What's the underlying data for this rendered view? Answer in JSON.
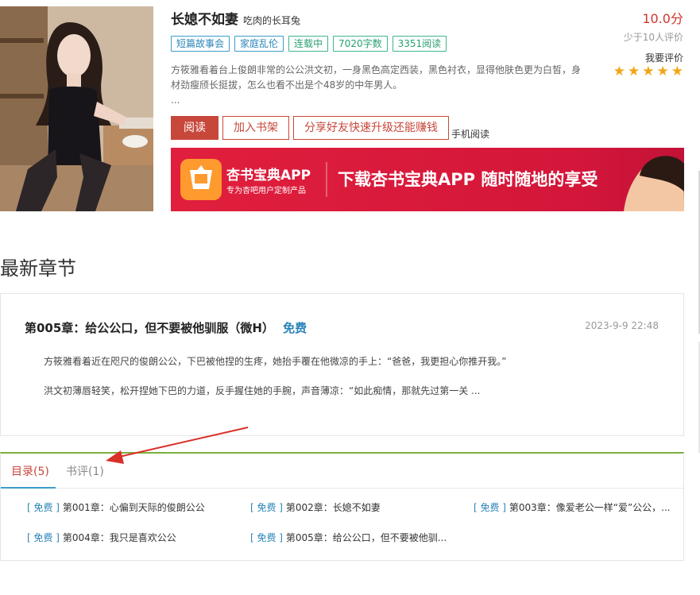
{
  "book": {
    "title": "长媳不如妻",
    "author": "吃肉的长耳兔",
    "tags": [
      {
        "label": "短篇故事会",
        "style": "blue"
      },
      {
        "label": "家庭乱伦",
        "style": "blue"
      },
      {
        "label": "连载中",
        "style": "green"
      },
      {
        "label": "7020字数",
        "style": "green"
      },
      {
        "label": "3351阅读",
        "style": "green"
      }
    ],
    "description": "方筱雅看着台上俊朗非常的公公洪文初，一身黑色高定西装，黑色衬衣，显得他肤色更为白皙，身材劲瘦颀长挺拔，怎么也看不出是个48岁的中年男人。",
    "description_more": "...",
    "cover_icon": "woman-portrait"
  },
  "rating": {
    "score": "10.0分",
    "raters": "少于10人评价",
    "rate_label": "我要评价",
    "stars": 5,
    "star_color": "#f2a516"
  },
  "actions": {
    "read": "阅读",
    "add_shelf": "加入书架",
    "share": "分享好友快速升级还能赚钱",
    "mobile": "手机阅读"
  },
  "banner": {
    "app_name": "杏书宝典APP",
    "app_sub": "专为杏吧用户定制产品",
    "slogan": "下载杏书宝典APP 随时随地的享受",
    "bg_color": "#d81c3a"
  },
  "latest": {
    "section_title": "最新章节",
    "chapter_title": "第005章：给公公口，但不要被他驯服（微H）",
    "free_label": "免费",
    "date": "2023-9-9 22:48",
    "paragraphs": [
      "方筱雅看着近在咫尺的俊朗公公，下巴被他捏的生疼，她抬手覆在他微凉的手上：“爸爸，我更担心你推开我。”",
      "洪文初薄唇轻笑，松开捏她下巴的力道，反手握住她的手腕，声音薄凉：“如此痴情，那就先过第一关 ..."
    ]
  },
  "toc": {
    "tabs": [
      {
        "label": "目录(5)",
        "active": true
      },
      {
        "label": "书评(1)",
        "active": false
      }
    ],
    "items": [
      {
        "free": "[ 免费 ]",
        "title": "第001章：心偏到天际的俊朗公公"
      },
      {
        "free": "[ 免费 ]",
        "title": "第002章：长媳不如妻"
      },
      {
        "free": "[ 免费 ]",
        "title": "第003章：像爱老公一样“爱”公公，..."
      },
      {
        "free": "[ 免费 ]",
        "title": "第004章：我只是喜欢公公"
      },
      {
        "free": "[ 免费 ]",
        "title": "第005章：给公公口，但不要被他驯..."
      }
    ]
  },
  "colors": {
    "accent_red": "#c8473b",
    "link_blue": "#2a84b8",
    "tag_green": "#28a06f",
    "divider_green": "#7ab03e",
    "annotation_arrow": "#d9302a"
  }
}
